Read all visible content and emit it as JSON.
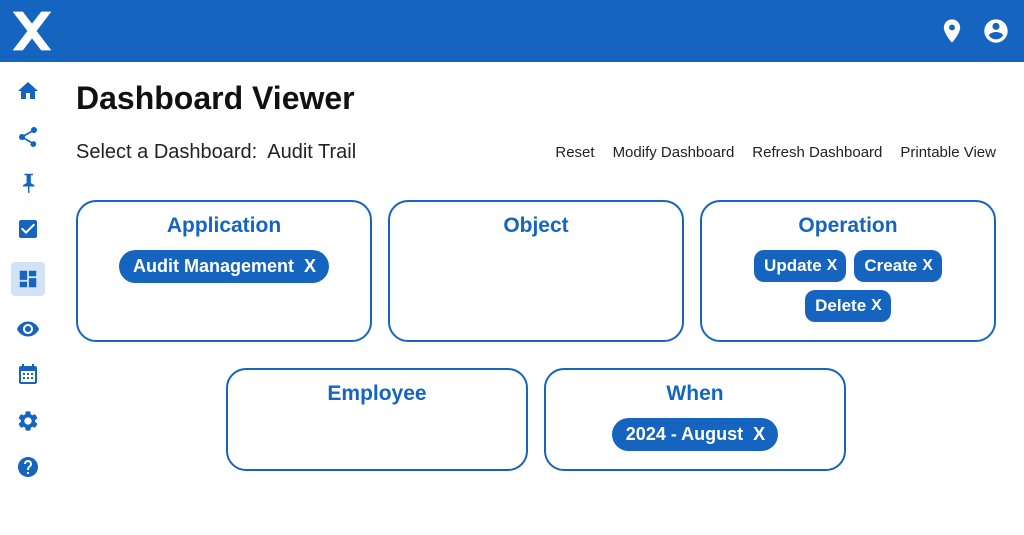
{
  "page": {
    "title": "Dashboard Viewer"
  },
  "selector": {
    "label": "Select a Dashboard:",
    "value": "Audit Trail"
  },
  "actions": {
    "reset": "Reset",
    "modify": "Modify Dashboard",
    "refresh": "Refresh Dashboard",
    "print": "Printable View"
  },
  "cards": {
    "application": {
      "title": "Application",
      "chips": [
        "Audit Management"
      ]
    },
    "object": {
      "title": "Object",
      "chips": []
    },
    "operation": {
      "title": "Operation",
      "chips": [
        "Update",
        "Create",
        "Delete"
      ]
    },
    "employee": {
      "title": "Employee",
      "chips": []
    },
    "when": {
      "title": "When",
      "chips": [
        "2024 - August"
      ]
    }
  },
  "close_glyph": "X",
  "colors": {
    "brand": "#1565c0"
  }
}
